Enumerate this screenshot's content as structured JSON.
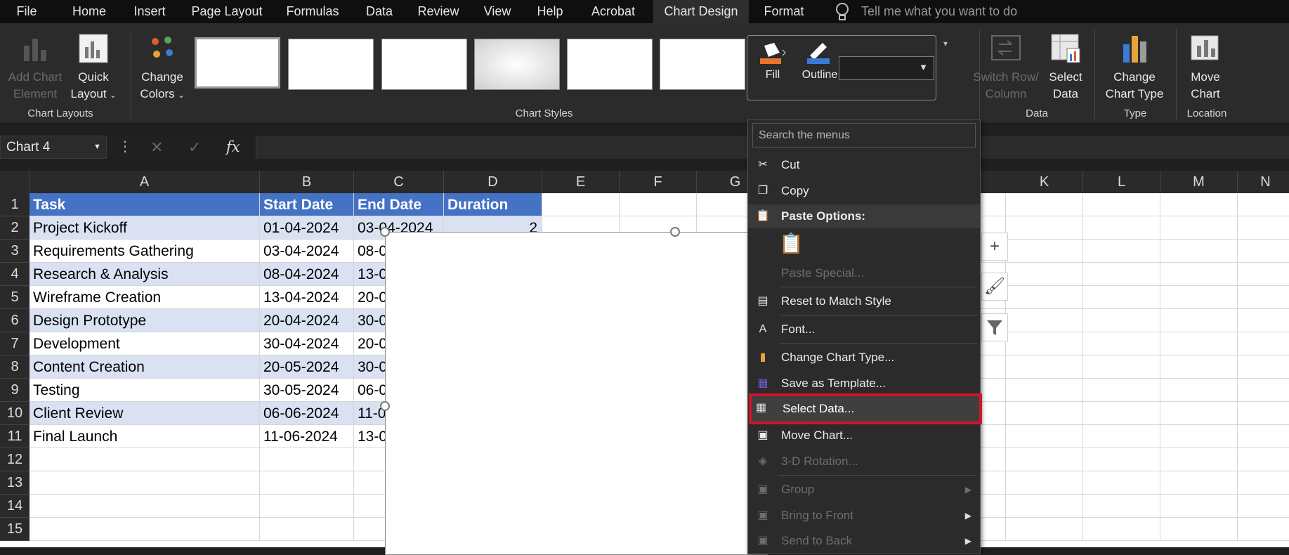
{
  "tabs": [
    "File",
    "Home",
    "Insert",
    "Page Layout",
    "Formulas",
    "Data",
    "Review",
    "View",
    "Help",
    "Acrobat",
    "Chart Design",
    "Format"
  ],
  "tell_me": "Tell me what you want to do",
  "ribbon": {
    "add_chart_element": "Add Chart Element",
    "add_chart_element_l1": "Add Chart",
    "add_chart_element_l2": "Element",
    "quick_layout_l1": "Quick",
    "quick_layout_l2": "Layout",
    "change_colors_l1": "Change",
    "change_colors_l2": "Colors",
    "group_layouts": "Chart Layouts",
    "group_styles": "Chart Styles",
    "fill": "Fill",
    "outline": "Outline",
    "switch_l1": "Switch Row/",
    "switch_l2": "Column",
    "select_data_l1": "Select",
    "select_data_l2": "Data",
    "group_data": "Data",
    "change_type_l1": "Change",
    "change_type_l2": "Chart Type",
    "group_type": "Type",
    "move_l1": "Move",
    "move_l2": "Chart",
    "group_location": "Location"
  },
  "formula_bar": {
    "name_box": "Chart 4",
    "fx": "fx"
  },
  "columns": [
    "A",
    "B",
    "C",
    "D",
    "E",
    "F",
    "G",
    "K",
    "L",
    "M",
    "N"
  ],
  "rows": [
    "1",
    "2",
    "3",
    "4",
    "5",
    "6",
    "7",
    "8",
    "9",
    "10",
    "11",
    "12",
    "13",
    "14",
    "15"
  ],
  "table": {
    "headers": [
      "Task",
      "Start Date",
      "End Date",
      "Duration"
    ],
    "rows": [
      [
        "Project Kickoff",
        "01-04-2024",
        "03-04-2024",
        "2"
      ],
      [
        "Requirements Gathering",
        "03-04-2024",
        "08-0",
        ""
      ],
      [
        "Research & Analysis",
        "08-04-2024",
        "13-0",
        ""
      ],
      [
        "Wireframe Creation",
        "13-04-2024",
        "20-0",
        ""
      ],
      [
        "Design Prototype",
        "20-04-2024",
        "30-0",
        ""
      ],
      [
        "Development",
        "30-04-2024",
        "20-0",
        ""
      ],
      [
        "Content Creation",
        "20-05-2024",
        "30-0",
        ""
      ],
      [
        "Testing",
        "30-05-2024",
        "06-0",
        ""
      ],
      [
        "Client Review",
        "06-06-2024",
        "11-0",
        ""
      ],
      [
        "Final Launch",
        "11-06-2024",
        "13-0",
        ""
      ]
    ]
  },
  "context_menu": {
    "search": "Search the menus",
    "cut": "Cut",
    "copy": "Copy",
    "paste_options": "Paste Options:",
    "paste_special": "Paste Special...",
    "reset": "Reset to Match Style",
    "font": "Font...",
    "change_type": "Change Chart Type...",
    "save_template": "Save as Template...",
    "select_data": "Select Data...",
    "move_chart": "Move Chart...",
    "rotation": "3-D Rotation...",
    "group": "Group",
    "bring_front": "Bring to Front",
    "send_back": "Send to Back"
  },
  "colors": {
    "accent_red": "#d0142b",
    "header_blue": "#4472c4",
    "band": "#d9e1f2"
  }
}
